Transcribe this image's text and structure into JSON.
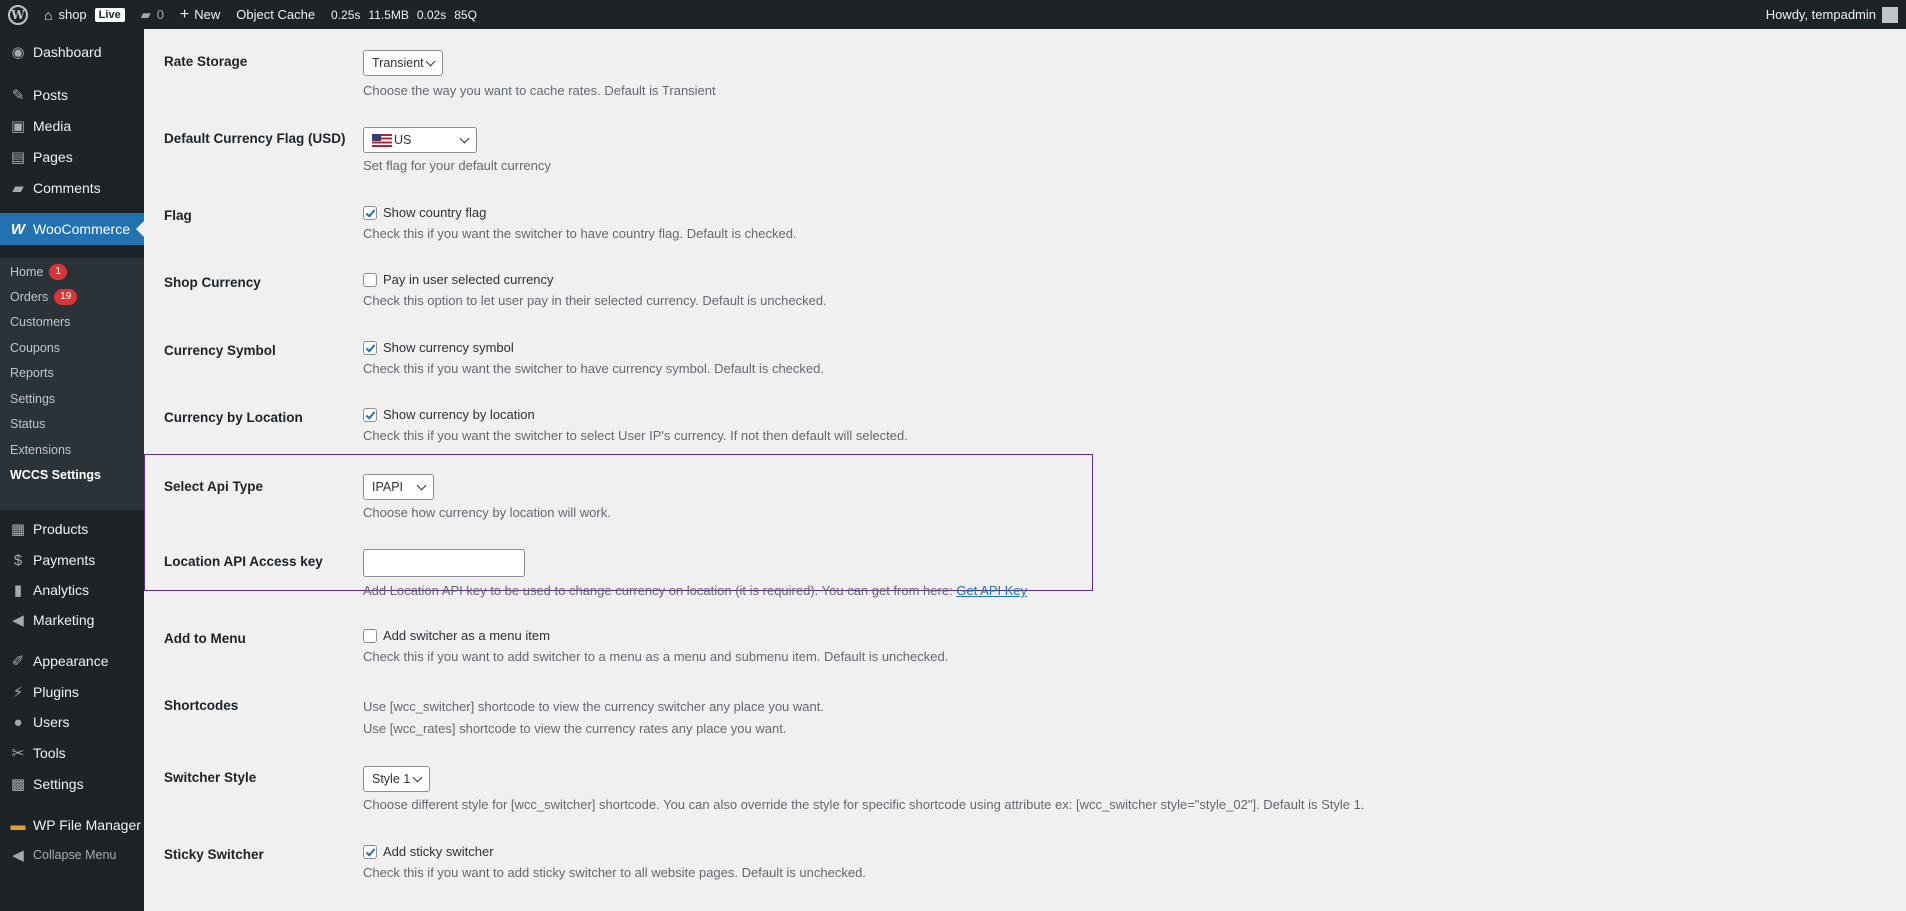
{
  "adminbar": {
    "site_name": "shop",
    "live_badge": "Live",
    "comments_count": "0",
    "new_label": "New",
    "object_cache": "Object Cache",
    "stats": [
      "0.25s",
      "11.5MB",
      "0.02s",
      "85Q"
    ],
    "howdy": "Howdy, tempadmin"
  },
  "sidebar": {
    "dashboard": "Dashboard",
    "posts": "Posts",
    "media": "Media",
    "pages": "Pages",
    "comments": "Comments",
    "woocommerce": "WooCommerce",
    "sub": {
      "home": "Home",
      "home_badge": "1",
      "orders": "Orders",
      "orders_badge": "19",
      "customers": "Customers",
      "coupons": "Coupons",
      "reports": "Reports",
      "settings": "Settings",
      "status": "Status",
      "extensions": "Extensions",
      "wccs": "WCCS Settings"
    },
    "products": "Products",
    "payments": "Payments",
    "analytics": "Analytics",
    "marketing": "Marketing",
    "appearance": "Appearance",
    "plugins": "Plugins",
    "users": "Users",
    "tools": "Tools",
    "settings": "Settings",
    "wp_file_manager": "WP File Manager",
    "collapse": "Collapse Menu"
  },
  "form": {
    "rate_storage": {
      "label": "Rate Storage",
      "value": "Transient",
      "desc": "Choose the way you want to cache rates. Default is Transient"
    },
    "default_flag": {
      "label": "Default Currency Flag (USD)",
      "value": "US",
      "desc": "Set flag for your default currency"
    },
    "flag": {
      "label": "Flag",
      "checkbox": "Show country flag",
      "checked": true,
      "desc": "Check this if you want the switcher to have country flag. Default is checked."
    },
    "shop_currency": {
      "label": "Shop Currency",
      "checkbox": "Pay in user selected currency",
      "checked": false,
      "desc": "Check this option to let user pay in their selected currency. Default is unchecked."
    },
    "currency_symbol": {
      "label": "Currency Symbol",
      "checkbox": "Show currency symbol",
      "checked": true,
      "desc": "Check this if you want the switcher to have currency symbol. Default is checked."
    },
    "currency_by_location": {
      "label": "Currency by Location",
      "checkbox": "Show currency by location",
      "checked": true,
      "desc": "Check this if you want the switcher to select User IP's currency. If not then default will selected."
    },
    "api_type": {
      "label": "Select Api Type",
      "value": "IPAPI",
      "desc": "Choose how currency by location will work."
    },
    "location_key": {
      "label": "Location API Access key",
      "value": "",
      "desc": "Add Location API key to be used to change currency on location (it is required). You can get from here:",
      "link": "Get API Key"
    },
    "add_to_menu": {
      "label": "Add to Menu",
      "checkbox": "Add switcher as a menu item",
      "checked": false,
      "desc": "Check this if you want to add switcher to a menu as a menu and submenu item. Default is unchecked."
    },
    "shortcodes": {
      "label": "Shortcodes",
      "desc1": "Use [wcc_switcher] shortcode to view the currency switcher any place you want.",
      "desc2": "Use [wcc_rates] shortcode to view the currency rates any place you want."
    },
    "switcher_style": {
      "label": "Switcher Style",
      "value": "Style 1",
      "desc": "Choose different style for [wcc_switcher] shortcode. You can also override the style for specific shortcode using attribute ex: [wcc_switcher style=\"style_02\"]. Default is Style 1."
    },
    "sticky_switcher": {
      "label": "Sticky Switcher",
      "checkbox": "Add sticky switcher",
      "checked": true,
      "desc": "Check this if you want to add sticky switcher to all website pages. Default is unchecked."
    }
  },
  "colors": {
    "accent": "#2271b1",
    "highlight_border": "#5b2c8a",
    "admin_dark": "#1d2327"
  }
}
